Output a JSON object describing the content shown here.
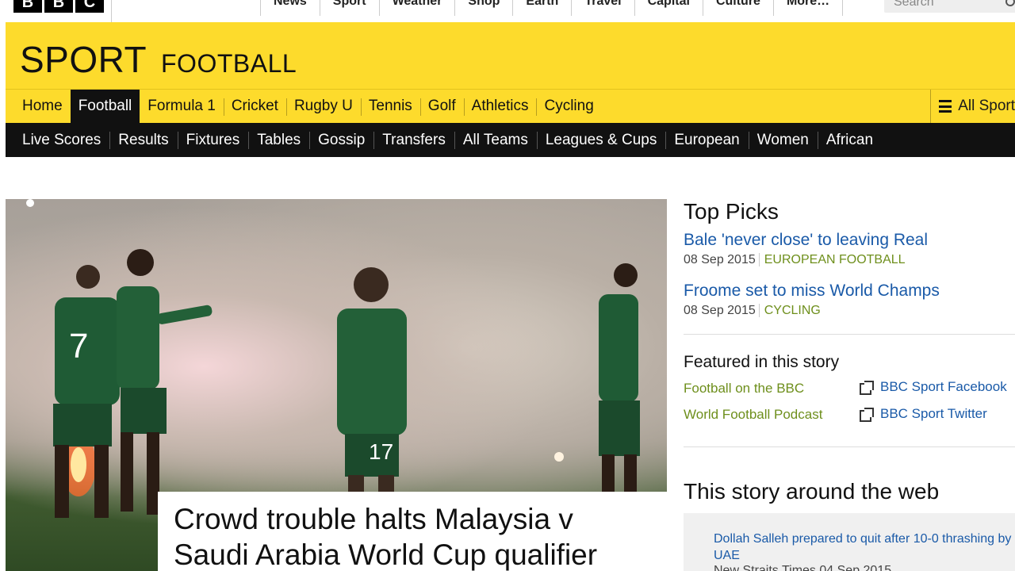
{
  "brand": {
    "logo_letters": [
      "B",
      "B",
      "C"
    ]
  },
  "top_nav": {
    "items": [
      "News",
      "Sport",
      "Weather",
      "Shop",
      "Earth",
      "Travel",
      "Capital",
      "Culture",
      "More…"
    ],
    "search_placeholder": "Search"
  },
  "header": {
    "sport_label": "SPORT",
    "section_label": "FOOTBALL"
  },
  "primary_nav": {
    "items": [
      "Home",
      "Football",
      "Formula 1",
      "Cricket",
      "Rugby U",
      "Tennis",
      "Golf",
      "Athletics",
      "Cycling"
    ],
    "active": "Football",
    "all_sport_label": "All Sport"
  },
  "secondary_nav": {
    "items": [
      "Live Scores",
      "Results",
      "Fixtures",
      "Tables",
      "Gossip",
      "Transfers",
      "All Teams",
      "Leagues & Cups",
      "European",
      "Women",
      "African"
    ]
  },
  "hero": {
    "headline": "Crowd trouble halts Malaysia v Saudi Arabia World Cup qualifier",
    "shirt_numbers": [
      "7",
      "17"
    ]
  },
  "top_picks": {
    "title": "Top Picks",
    "items": [
      {
        "title": "Bale 'never close' to leaving Real",
        "date": "08 Sep 2015",
        "category": "EUROPEAN FOOTBALL"
      },
      {
        "title": "Froome set to miss World Champs",
        "date": "08 Sep 2015",
        "category": "CYCLING"
      }
    ]
  },
  "featured": {
    "title": "Featured in this story",
    "internal_links": [
      "Football on the BBC",
      "World Football Podcast"
    ],
    "external_links": [
      "BBC Sport Facebook",
      "BBC Sport Twitter"
    ]
  },
  "around_web": {
    "title": "This story around the web",
    "items": [
      {
        "title": "Dollah Salleh prepared to quit after 10-0 thrashing by UAE",
        "source": "New Straits Times",
        "date": "04 Sep 2015"
      }
    ]
  },
  "colors": {
    "brand_yellow": "#fddb2c",
    "nav_black": "#111111",
    "link_blue": "#1a5aa8",
    "category_green": "#6e8f1c"
  }
}
